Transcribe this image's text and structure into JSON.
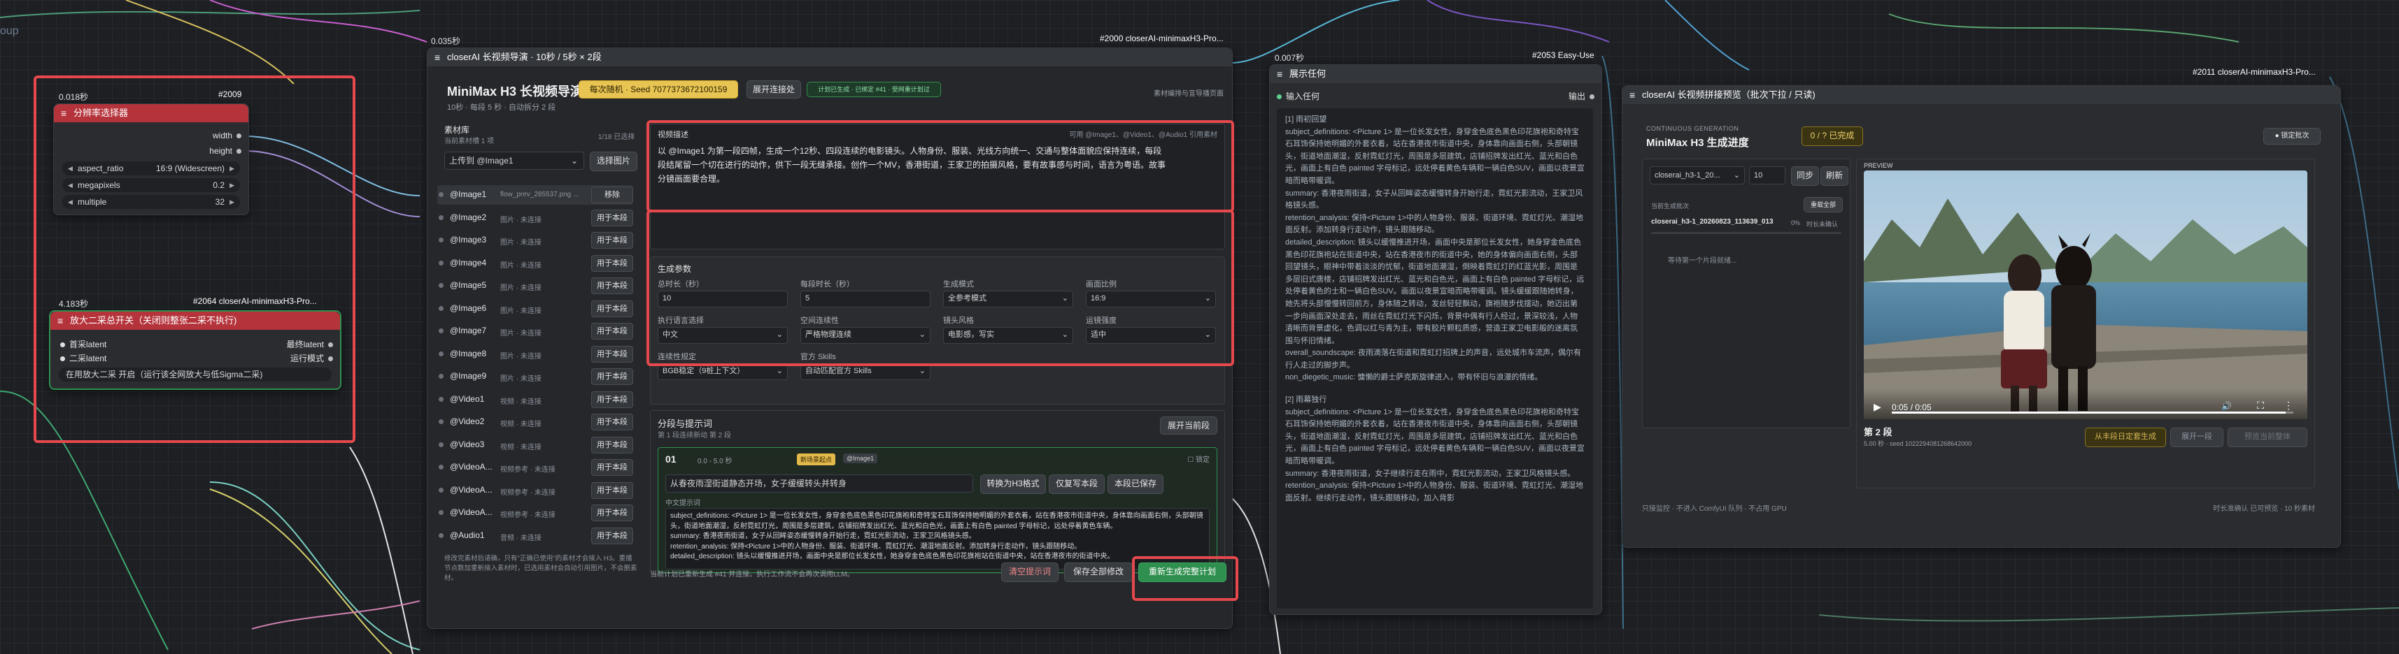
{
  "canvas": {
    "corner_label": "oup"
  },
  "resolution_node": {
    "timer": "0.018秒",
    "id_badge": "#2009",
    "title": "分辨率选择器",
    "outputs": [
      "width",
      "height"
    ],
    "widgets": [
      {
        "label": "aspect_ratio",
        "value": "16:9 (Widescreen)"
      },
      {
        "label": "megapixels",
        "value": "0.2"
      },
      {
        "label": "multiple",
        "value": "32"
      }
    ]
  },
  "upscale_node": {
    "timer": "4.183秒",
    "id_badge": "#2064 closerAI-minimaxH3-Pro...",
    "title": "放大二采总开关（关闭则整张二采不执行)",
    "inputs": [
      "首采latent",
      "二采latent"
    ],
    "outputs": [
      "最终latent",
      "运行模式"
    ],
    "widget": "在用放大二采  开启（运行该全网放大与低Sigma二采)"
  },
  "guide_node": {
    "timer": "0.035秒",
    "id_badge": "#2000 closerAI-minimaxH3-Pro...",
    "title": "closerAI 长视频导演 · 10秒 / 5秒 × 2段",
    "header_title": "MiniMax H3 长视频导演",
    "header_sub": "10秒 · 每段 5 秒 · 自动拆分 2 段",
    "seed_button": "每次随机 · Seed 7077373672100159",
    "connect_button": "展开连接处",
    "status_chip": "计划已生成 · 已绑定 #41 · 受网重计划过",
    "top_hint": "素材编排与宣导播页面",
    "assets": {
      "title": "素材库",
      "hint": "当前素材槽 1 项",
      "count": "1/18 已选择",
      "select_value": "上传到 @Image1",
      "select_button": "选择图片",
      "list": [
        {
          "name": "@Image1",
          "sub": "flow_prev_285537.png ...",
          "btn": "移除"
        },
        {
          "name": "@Image2",
          "sub": "图片 · 未连接",
          "btn": "用于本段"
        },
        {
          "name": "@Image3",
          "sub": "图片 · 未连接",
          "btn": "用于本段"
        },
        {
          "name": "@Image4",
          "sub": "图片 · 未连接",
          "btn": "用于本段"
        },
        {
          "name": "@Image5",
          "sub": "图片 · 未连接",
          "btn": "用于本段"
        },
        {
          "name": "@Image6",
          "sub": "图片 · 未连接",
          "btn": "用于本段"
        },
        {
          "name": "@Image7",
          "sub": "图片 · 未连接",
          "btn": "用于本段"
        },
        {
          "name": "@Image8",
          "sub": "图片 · 未连接",
          "btn": "用于本段"
        },
        {
          "name": "@Image9",
          "sub": "图片 · 未连接",
          "btn": "用于本段"
        },
        {
          "name": "@Video1",
          "sub": "视频 · 未连接",
          "btn": "用于本段"
        },
        {
          "name": "@Video2",
          "sub": "视频 · 未连接",
          "btn": "用于本段"
        },
        {
          "name": "@Video3",
          "sub": "视频 · 未连接",
          "btn": "用于本段"
        },
        {
          "name": "@VideoA...",
          "sub": "视频参考 · 未连接",
          "btn": "用于本段"
        },
        {
          "name": "@VideoA...",
          "sub": "视频参考 · 未连接",
          "btn": "用于本段"
        },
        {
          "name": "@VideoA...",
          "sub": "视频参考 · 未连接",
          "btn": "用于本段"
        },
        {
          "name": "@Audio1",
          "sub": "音频 · 未连接",
          "btn": "用于本段"
        }
      ],
      "footer": "修改完素材后请确，只有\"正确已使用\"的素材才会接入 H3。重播节点数加重新接入素材时，已选用素材会自动引用图片，不会删素材。"
    },
    "script": {
      "label": "视频描述",
      "hint": "可用 @Image1、@Video1、@Audio1 引用素材",
      "text": "以 @Image1 为第一段四帧，生成一个12秒、四段连续的电影镜头。人物身份、服装、光线方向统一、交通与整体面貌应保持连续，每段段结尾留一个切在进行的动作，供下一段无缝承接。创作一个MV，香港街道，王家卫的拍摄风格，要有故事感与时间，语言为粤语。故事分镜画面要合理。"
    },
    "params": {
      "title": "生成参数",
      "fields": [
        {
          "label": "总时长（秒）",
          "value": "10"
        },
        {
          "label": "每段时长（秒）",
          "value": "5"
        },
        {
          "label": "生成模式",
          "value": "全参考模式"
        },
        {
          "label": "画面比例",
          "value": "16:9"
        },
        {
          "label": "执行语言选择",
          "value": "中文"
        },
        {
          "label": "空间连续性",
          "value": "严格物理连续"
        },
        {
          "label": "镜头风格",
          "value": "电影感，写实"
        },
        {
          "label": "运镜强度",
          "value": "适中"
        },
        {
          "label": "连续性规定",
          "value": "BGB稳定（9桩上下文）"
        },
        {
          "label": "官方 Skills",
          "value": "自动匹配官方 Skills"
        }
      ]
    },
    "segments": {
      "title": "分段与提示词",
      "sub": "第 1 段连续新动 第 2 段",
      "expand_button": "展开当前段",
      "card": {
        "index": "01",
        "range": "0.0 - 5.0 秒",
        "tag": "新场景起点",
        "ref": "@Image1",
        "lock_label": "锁定",
        "title_value": "从春夜雨湿街道静态开场，女子缓缓转头并转身",
        "btn_convert": "转换为H3格式",
        "btn_write": "仅复写本段",
        "btn_save": "本段已保存",
        "prompt_label": "中文提示词",
        "prompt": "subject_definitions: <Picture 1> 是一位长发女性，身穿金色底色黑色印花旗袍和奇特宝石耳饰保持她明媚的外套衣着，站在香港夜市街道中央，身体靠向画面右侧，头部朝镜头，街道地面潮湿，反射霓虹灯光，周围是多层建筑，店铺招牌发出红光、蓝光和白色光，画面上有白色 painted 字母标记，远处停着黄色车辆。\nsummary: 香港夜雨街道，女子从回眸姿态缓慢转身开始行走，霓虹光影流动，王家卫风格镜头感。\nretention_analysis: 保持<Picture 1>中的人物身份、服装、街道环境、霓虹灯光、潮湿地面反射。添加转身行走动作，镜头跟随移动。\ndetailed_description: 镜头以缓慢推进开场，画面中央是那位长发女性，她身穿金色底色黑色印花旗袍站在街道中央，站在香港夜市的街道中央。"
      },
      "footer": "当前计划已重新生成 #41 并连接。执行工作流不会再次调用LLM。",
      "clear_button": "清空提示词",
      "save_all_button": "保存全部修改",
      "regen_button": "重新生成完整计划"
    }
  },
  "show_node": {
    "timer": "0.007秒",
    "id_badge": "#2053 Easy-Use",
    "title": "展示任何",
    "input_label": "输入任何",
    "output_label": "输出",
    "sections": [
      {
        "heading": "[1] 雨初回望",
        "text": "subject_definitions: <Picture 1> 是一位长发女性，身穿金色底色黑色印花旗袍和奇特宝石耳饰保持她明媚的外套衣着，站在香港夜市街道中央，身体靠向画面右侧，头部朝镜头，街道地面潮湿，反射霓虹灯光，周围是多层建筑，店铺招牌发出红光、蓝光和白色光，画面上有白色 painted 字母标记，远处停着黄色车辆和一辆白色SUV，画面以夜景宣暗而略带暖调。\nsummary: 香港夜雨街道，女子从回眸姿态缓慢转身开始行走，霓虹光影流动，王家卫风格镜头感。\nretention_analysis: 保持<Picture 1>中的人物身份、服装、街道环境、霓虹灯光、潮湿地面反射。添加转身行走动作，镜头跟随移动。\ndetailed_description: 镜头以缓慢推进开场，画面中央是那位长发女性，她身穿金色底色黑色印花旗袍站在街道中央，站在香港夜市的街道中央，她的身体偏向画面右侧，头部回望镜头，眼神中带着淡淡的忧郁，街道地面潮湿，倒映着霓虹灯的红蓝光影，周围是多层旧式唐楼，店铺招牌发出红光、蓝光和白色光，画面上有白色 painted 字母标记，远处停着黄色的士和一辆白色SUV。画面以夜景宣暗而略带暖调。镜头缓缓跟随她转身，她先将头部慢慢转回前方，身体随之转动，发丝轻轻飘动，旗袍随步伐摆动，她迈出第一步向画面深处走去，雨丝在霓虹灯光下闪烁，背景中偶有行人经过，景深较浅，人物清晰而背景虚化，色调以红与青为主，带有胶片颗粒质感，营造王家卫电影般的迷离氛围与怀旧情绪。\noverall_soundscape: 夜雨滴落在街道和霓虹灯招牌上的声音，远处城市车流声，偶尔有行人走过的脚步声。\nnon_diegetic_music: 慵懒的爵士萨克斯旋律进入，带有怀旧与浪漫的情绪。"
      },
      {
        "heading": "[2] 雨幕独行",
        "text": "subject_definitions: <Picture 1> 是一位长发女性，身穿金色底色黑色印花旗袍和奇特宝石耳饰保持她明媚的外套衣着，站在香港夜市街道中央，身体靠向画面右侧，头部朝镜头，街道地面潮湿，反射霓虹灯光，周围是多层建筑，店铺招牌发出红光、蓝光和白色光，画面上有白色 painted 字母标记，远处停着黄色车辆和一辆白色SUV，画面以夜景宣暗而略带暖调。\nsummary: 香港夜雨街道，女子继续行走在雨中，霓虹光影流动，王家卫风格镜头感。\nretention_analysis: 保持<Picture 1>中的人物身份、服装、街道环境、霓虹灯光、潮湿地面反射。继续行走动作，镜头跟随移动，加入背影"
      }
    ]
  },
  "preview_node": {
    "id_badge": "#2011 closerAI-minimaxH3-Pro...",
    "title": "closerAI 长视频拼接预览（批次下拉 / 只读)",
    "gen_label": "CONTINUOUS GENERATION",
    "gen_title": "MiniMax H3 生成进度",
    "progress_badge": "0 / ? 已完成",
    "lock_button": "● 锁定批次",
    "batch_select": "closerai_h3-1_20...",
    "batch_num": "10",
    "sync_button": "同步",
    "refresh_button": "刷新",
    "row_label": "当前生成批次",
    "row_btn": "重载全部",
    "file_name": "closerai_h3-1_20260823_113639_013",
    "file_pct": "0%",
    "file_status": "时长未确认",
    "waiting": "等待第一个片段就绪...",
    "preview_label": "PREVIEW",
    "video_time": "0:05 / 0:05",
    "video_progress": 0.98,
    "seg_title": "第 2 段",
    "seg_sub": "5.00 秒 · seed 1022294081268642000",
    "btn_continue": "从丰段日定套生成",
    "btn_prev": "展开一段",
    "btn_export": "预览当前整体",
    "footer_left": "只接监控 · 不进入 ComfyUI 队列 · 不占用 GPU",
    "footer_right": "时长准确认 已可预览 · 10 秒素材"
  },
  "colors": {
    "red_title": "#b5343c",
    "highlight_red": "#e5484d",
    "accent_green": "#2d8a4e",
    "gold": "#e4b94b"
  }
}
